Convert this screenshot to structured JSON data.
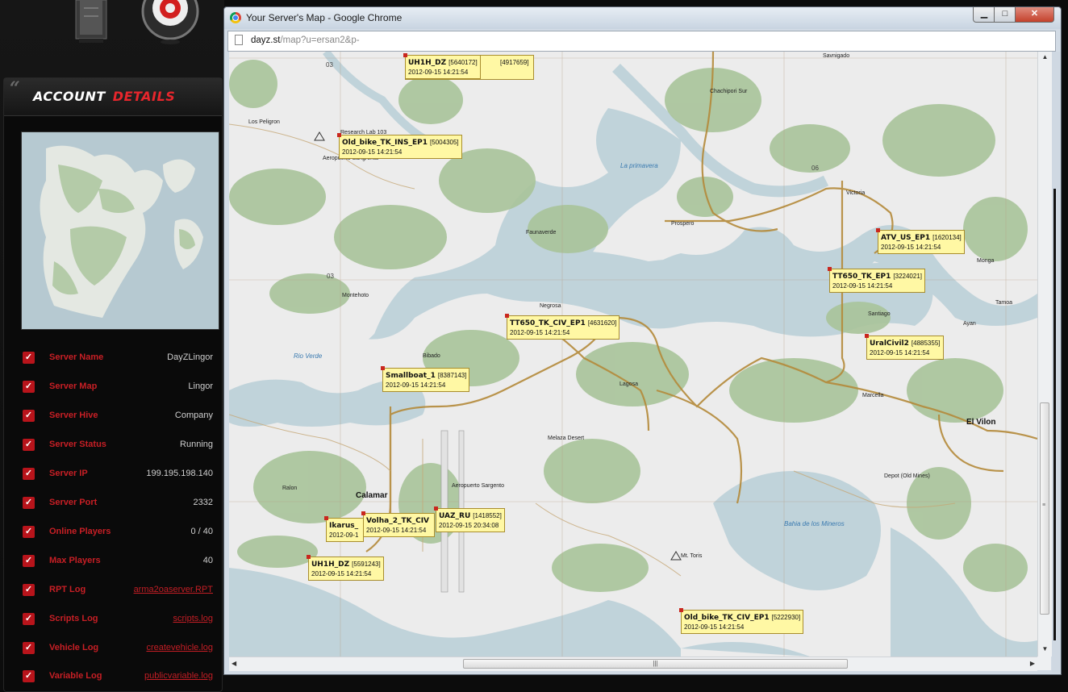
{
  "account_panel": {
    "title_word1": "ACCOUNT",
    "title_word2": "DETAILS",
    "rows": [
      {
        "label": "Server Name",
        "value": "DayZLingor",
        "is_link": false
      },
      {
        "label": "Server Map",
        "value": "Lingor",
        "is_link": false
      },
      {
        "label": "Server Hive",
        "value": "Company",
        "is_link": false
      },
      {
        "label": "Server Status",
        "value": "Running",
        "is_link": false
      },
      {
        "label": "Server IP",
        "value": "199.195.198.140",
        "is_link": false
      },
      {
        "label": "Server Port",
        "value": "2332",
        "is_link": false
      },
      {
        "label": "Online Players",
        "value": "0 / 40",
        "is_link": false
      },
      {
        "label": "Max Players",
        "value": "40",
        "is_link": false
      },
      {
        "label": "RPT Log",
        "value": "arma2oaserver.RPT",
        "is_link": true
      },
      {
        "label": "Scripts Log",
        "value": "scripts.log",
        "is_link": true
      },
      {
        "label": "Vehicle Log",
        "value": "createvehicle.log",
        "is_link": true
      },
      {
        "label": "Variable Log",
        "value": "publicvariable.log",
        "is_link": true
      }
    ]
  },
  "browser": {
    "window_title": "Your Server's Map - Google Chrome",
    "url_host": "dayz.st",
    "url_path": "/map?u=ersan2&p-",
    "min_glyph": "▁",
    "max_glyph": "□",
    "close_glyph": "✕"
  },
  "map": {
    "towns": [
      {
        "name": "Los Peligron",
        "big": false
      },
      {
        "name": "Research Lab 103",
        "big": false
      },
      {
        "name": "Aeropuerto Sangrenta",
        "big": false
      },
      {
        "name": "Savnigado",
        "big": false
      },
      {
        "name": "Chachipori Sur",
        "big": false
      },
      {
        "name": "La primavera",
        "big": false
      },
      {
        "name": "Prospero",
        "big": false
      },
      {
        "name": "Victoria",
        "big": false
      },
      {
        "name": "Faunaverde",
        "big": false
      },
      {
        "name": "Montehoto",
        "big": false
      },
      {
        "name": "Negrosa",
        "big": false
      },
      {
        "name": "Bibado",
        "big": false
      },
      {
        "name": "Lagosa",
        "big": false
      },
      {
        "name": "Santiago",
        "big": false
      },
      {
        "name": "Ayan",
        "big": false
      },
      {
        "name": "Monga",
        "big": false
      },
      {
        "name": "Tamoa",
        "big": false
      },
      {
        "name": "Marcella",
        "big": false
      },
      {
        "name": "Rio Verde",
        "big": false
      },
      {
        "name": "Melaza Desert",
        "big": false
      },
      {
        "name": "Aeropuerto Sargento",
        "big": false
      },
      {
        "name": "Ralon",
        "big": false
      },
      {
        "name": "Depot (Old Mines)",
        "big": false
      },
      {
        "name": "Bahia de los Mineros",
        "big": false
      },
      {
        "name": "Mt. Toris",
        "big": false
      },
      {
        "name": "Calamar",
        "big": true
      },
      {
        "name": "El Vilon",
        "big": true
      }
    ],
    "grid_numbers": [
      "03",
      "03",
      "06"
    ],
    "vehicles": [
      {
        "name": "UH1H_DZ",
        "id": "[5640172]",
        "time": "2012-09-15 14:21:54"
      },
      {
        "name": "",
        "id": "[4917659]",
        "time": ""
      },
      {
        "name": "Old_bike_TK_INS_EP1",
        "id": "[5004305]",
        "time": "2012-09-15 14:21:54"
      },
      {
        "name": "ATV_US_EP1",
        "id": "[1620134]",
        "time": "2012-09-15 14:21:54"
      },
      {
        "name": "TT650_TK_EP1",
        "id": "[3224021]",
        "time": "2012-09-15 14:21:54"
      },
      {
        "name": "TT650_TK_CIV_EP1",
        "id": "[4631620]",
        "time": "2012-09-15 14:21:54"
      },
      {
        "name": "UralCivil2",
        "id": "[4885355]",
        "time": "2012-09-15 14:21:54"
      },
      {
        "name": "Smallboat_1",
        "id": "[8387143]",
        "time": "2012-09-15 14:21:54"
      },
      {
        "name": "Ikarus_",
        "id": "",
        "time": "2012-09-1"
      },
      {
        "name": "Volha_2_TK_CIV",
        "id": "",
        "time": "2012-09-15 14:21:54"
      },
      {
        "name": "UAZ_RU",
        "id": "[1418552]",
        "time": "2012-09-15 20:34:08"
      },
      {
        "name": "UH1H_DZ",
        "id": "[5591243]",
        "time": "2012-09-15 14:21:54"
      },
      {
        "name": "Old_bike_TK_CIV_EP1",
        "id": "[5222930]",
        "time": "2012-09-15 14:21:54"
      }
    ]
  },
  "colors": {
    "accent_red": "#c81f25",
    "tag_yellow": "#fff8a4",
    "water": "#c0d3da",
    "land": "#ececec",
    "forest": "#a9c49a"
  }
}
